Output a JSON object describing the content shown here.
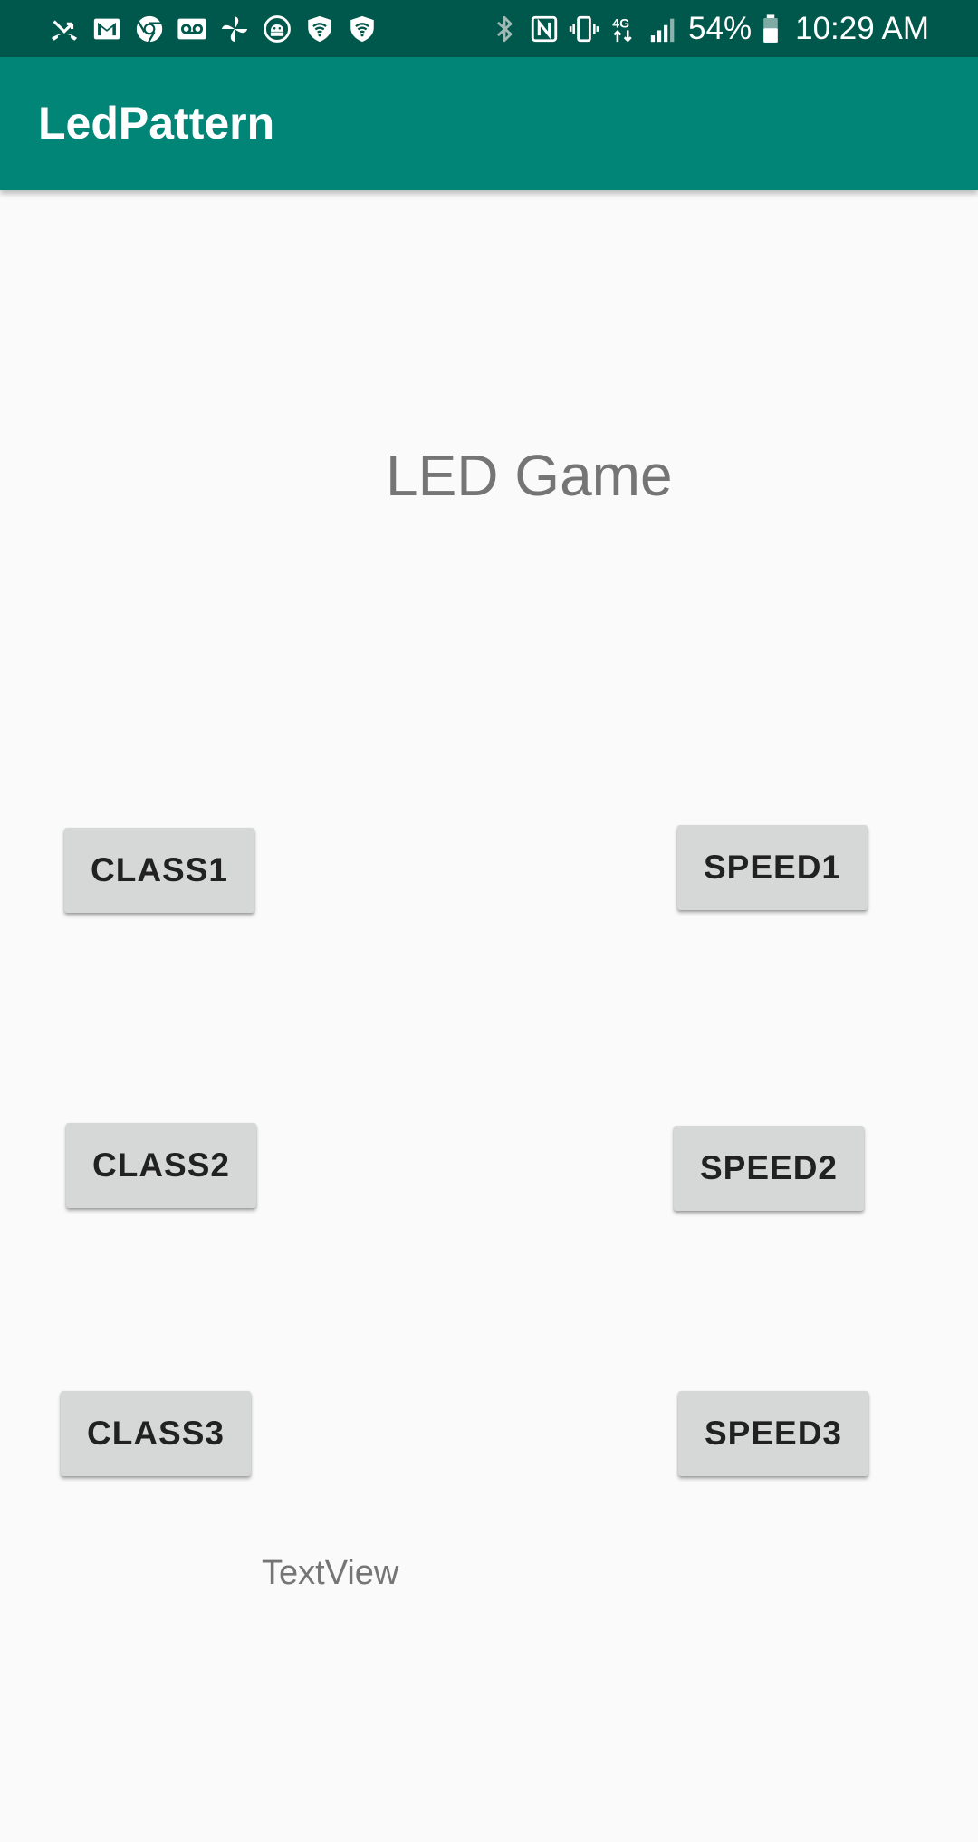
{
  "status_bar": {
    "left_icons": [
      "missed-call-icon",
      "gmail-icon",
      "chrome-icon",
      "voicemail-icon",
      "pinwheel-icon",
      "android-debug-icon",
      "wifi-shield-icon",
      "wifi-shield-icon"
    ],
    "right_icons": [
      "bluetooth-icon",
      "nfc-icon",
      "vibrate-icon",
      "data-4g-icon",
      "signal-icon",
      "battery-icon"
    ],
    "battery_percent": "54%",
    "time": "10:29 AM",
    "colors": {
      "background": "#00574b",
      "icon": "#ffffff"
    }
  },
  "app_bar": {
    "title": "LedPattern",
    "color": "#008577"
  },
  "main": {
    "headline": "LED Game",
    "buttons": {
      "class1": "CLASS1",
      "class2": "CLASS2",
      "class3": "CLASS3",
      "speed1": "SPEED1",
      "speed2": "SPEED2",
      "speed3": "SPEED3"
    },
    "textview": "TextView",
    "colors": {
      "background": "#fafafa",
      "button": "#d6d7d7",
      "button_text": "#212121",
      "secondary_text": "#757575"
    }
  }
}
